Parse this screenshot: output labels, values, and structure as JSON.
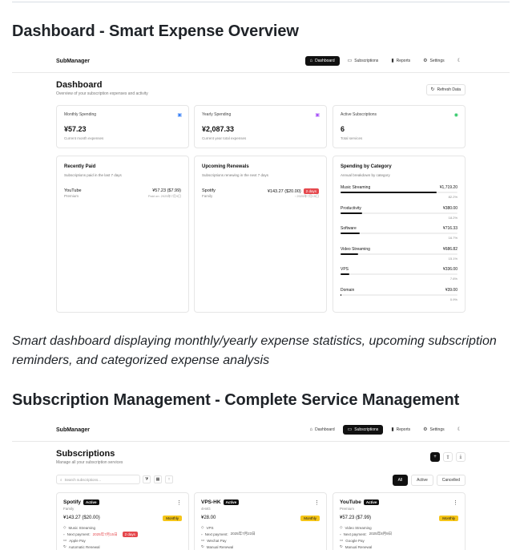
{
  "heading1": "Dashboard - Smart Expense Overview",
  "caption1": "Smart dashboard displaying monthly/yearly expense statistics, upcoming subscription reminders, and categorized expense analysis",
  "heading2": "Subscription Management - Complete Service Management",
  "app": {
    "brand": "SubManager",
    "nav": [
      {
        "label": "Dashboard",
        "icon": "home-icon"
      },
      {
        "label": "Subscriptions",
        "icon": "card-icon"
      },
      {
        "label": "Reports",
        "icon": "chart-icon"
      },
      {
        "label": "Settings",
        "icon": "gear-icon"
      }
    ],
    "theme_icon": "moon-icon"
  },
  "dashboard": {
    "title": "Dashboard",
    "subtitle": "Overview of your subscription expenses and activity",
    "refresh_label": "Refresh Data",
    "stats": [
      {
        "label": "Monthly Spending",
        "value": "¥57.23",
        "hint": "Current month expenses",
        "icon": "calendar-icon",
        "color": "#3b82f6"
      },
      {
        "label": "Yearly Spending",
        "value": "¥2,087.33",
        "hint": "Current year total expenses",
        "icon": "calendar-icon",
        "color": "#a855f7"
      },
      {
        "label": "Active Subscriptions",
        "value": "6",
        "hint": "Total services",
        "icon": "check-circle-icon",
        "color": "#22c55e"
      }
    ],
    "recently_paid": {
      "title": "Recently Paid",
      "subtitle": "Subscriptions paid in the last 7 days",
      "items": [
        {
          "name": "YouTube",
          "plan": "Premium",
          "amount": "¥57.23 ($7.99)",
          "date": "Paid on: 2025年7月9日"
        }
      ]
    },
    "upcoming": {
      "title": "Upcoming Renewals",
      "subtitle": "Subscriptions renewing in the next 7 days",
      "items": [
        {
          "name": "Spotify",
          "plan": "Family",
          "amount": "¥143.27 ($20.00)",
          "badge": "2 days",
          "date": "2025年7月15日"
        }
      ]
    },
    "categories": {
      "title": "Spending by Category",
      "subtitle": "Annual breakdown by category",
      "items": [
        {
          "name": "Music Streaming",
          "amount": "¥1,719.20",
          "percent": "82.2%",
          "fraction": 0.822
        },
        {
          "name": "Productivity",
          "amount": "¥380.00",
          "percent": "18.2%",
          "fraction": 0.182
        },
        {
          "name": "Software",
          "amount": "¥716.33",
          "percent": "16.7%",
          "fraction": 0.167
        },
        {
          "name": "Video Streaming",
          "amount": "¥686.82",
          "percent": "15.1%",
          "fraction": 0.151
        },
        {
          "name": "VPS",
          "amount": "¥336.00",
          "percent": "7.6%",
          "fraction": 0.076
        },
        {
          "name": "Domain",
          "amount": "¥39.00",
          "percent": "0.9%",
          "fraction": 0.009
        }
      ]
    }
  },
  "subscriptions": {
    "title": "Subscriptions",
    "subtitle": "Manage all your subscription services",
    "search_placeholder": "Search subscriptions...",
    "filters": [
      "All",
      "Active",
      "Cancelled"
    ],
    "cards": [
      {
        "name": "Spotify",
        "status": "Active",
        "plan": "Family",
        "price": "¥143.27 ($20.00)",
        "cycle": "Monthly",
        "category": "Music Streaming",
        "next_label": "Next payment:",
        "next": "2025年7月15日",
        "next_badge": "2 days",
        "payment": "Apple Pay",
        "renewal": "Automatic Renewal"
      },
      {
        "name": "VPS-HK",
        "status": "Active",
        "plan": "4H4G",
        "price": "¥28.00",
        "cycle": "Monthly",
        "category": "VPS",
        "next_label": "Next payment:",
        "next": "2025年7月23日",
        "next_badge": "",
        "payment": "Wechat Pay",
        "renewal": "Manual Renewal"
      },
      {
        "name": "YouTube",
        "status": "Active",
        "plan": "Premium",
        "price": "¥57.23 ($7.99)",
        "cycle": "Monthly",
        "category": "Video Streaming",
        "next_label": "Next payment:",
        "next": "2025年8月9日",
        "next_badge": "",
        "payment": "Google Pay",
        "renewal": "Manual Renewal"
      }
    ]
  }
}
